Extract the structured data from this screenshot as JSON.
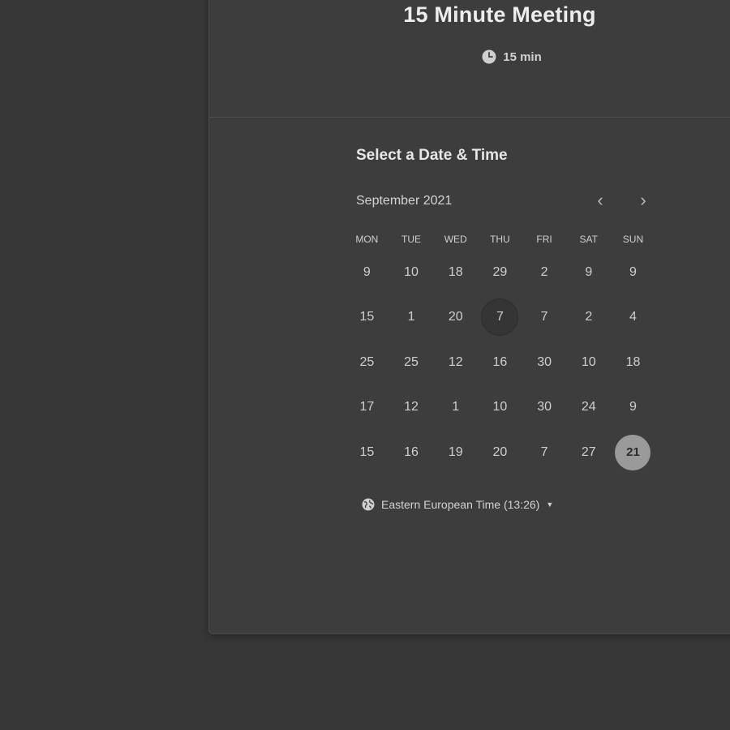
{
  "event": {
    "title": "15 Minute Meeting",
    "duration": "15 min",
    "duration_icon": "clock-icon"
  },
  "scheduler": {
    "section_title": "Select a Date & Time",
    "month_label": "September 2021",
    "prev_icon": "chevron-left-icon",
    "next_icon": "chevron-right-icon",
    "prev_glyph": "‹",
    "next_glyph": "›",
    "weekdays": [
      "MON",
      "TUE",
      "WED",
      "THU",
      "FRI",
      "SAT",
      "SUN"
    ],
    "days": [
      "9",
      "10",
      "18",
      "29",
      "2",
      "9",
      "9",
      "15",
      "1",
      "20",
      "7",
      "7",
      "2",
      "4",
      "25",
      "25",
      "12",
      "16",
      "30",
      "10",
      "18",
      "17",
      "12",
      "1",
      "10",
      "30",
      "24",
      "9",
      "15",
      "16",
      "19",
      "20",
      "7",
      "27",
      "21"
    ],
    "today_index": 10,
    "selected_index": 34
  },
  "timezone": {
    "label": "Eastern European Time (13:26)",
    "icon": "globe-icon",
    "caret": "▼"
  },
  "colors": {
    "page_bg": "#373737",
    "card_bg": "#3d3d3d",
    "selected_bg": "#9a9a9a"
  }
}
